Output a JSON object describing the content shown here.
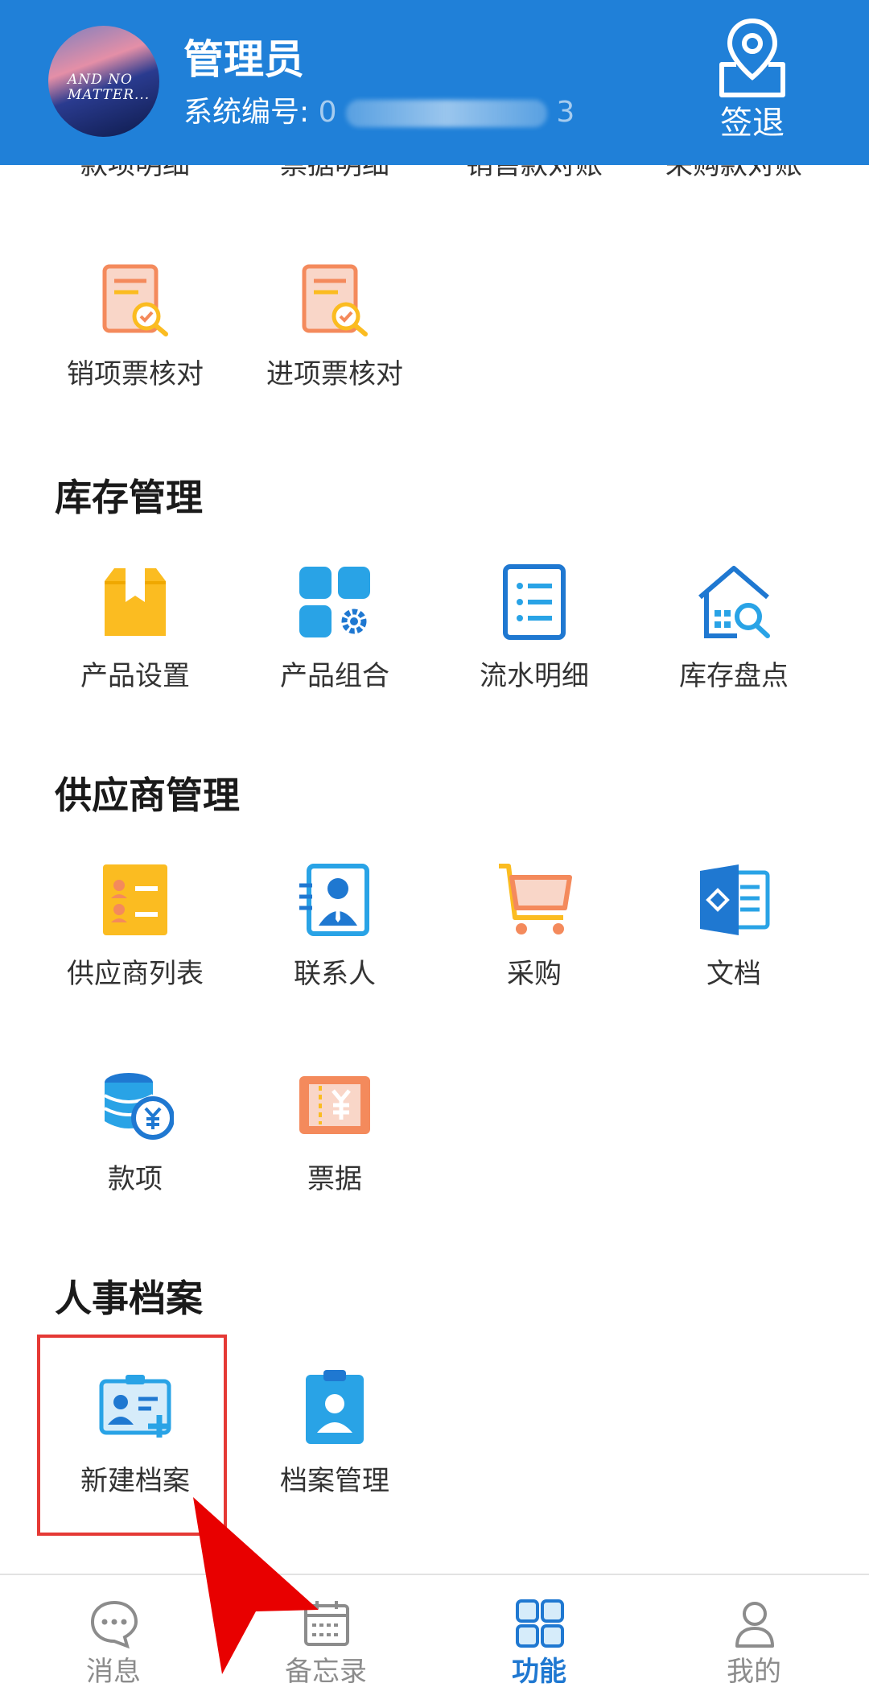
{
  "header": {
    "avatar_text": "AND NO MATTER...",
    "user_name": "管理员",
    "system_no_label": "系统编号:",
    "system_no_value_start": "0",
    "system_no_value_end": "3",
    "logout_label": "签退"
  },
  "top_cut_row": {
    "items": [
      "款项明细",
      "票据明细",
      "销售款对账",
      "采购款对账"
    ]
  },
  "finance_row2": {
    "items": [
      {
        "label": "销项票核对",
        "icon": "invoice-check-icon"
      },
      {
        "label": "进项票核对",
        "icon": "invoice-check-icon"
      }
    ]
  },
  "inventory": {
    "title": "库存管理",
    "items": [
      {
        "label": "产品设置",
        "icon": "product-box-icon"
      },
      {
        "label": "产品组合",
        "icon": "product-combo-icon"
      },
      {
        "label": "流水明细",
        "icon": "list-detail-icon"
      },
      {
        "label": "库存盘点",
        "icon": "warehouse-search-icon"
      }
    ]
  },
  "supplier": {
    "title": "供应商管理",
    "items": [
      {
        "label": "供应商列表",
        "icon": "supplier-list-icon"
      },
      {
        "label": "联系人",
        "icon": "contact-icon"
      },
      {
        "label": "采购",
        "icon": "cart-icon"
      },
      {
        "label": "文档",
        "icon": "document-icon"
      },
      {
        "label": "款项",
        "icon": "coins-icon"
      },
      {
        "label": "票据",
        "icon": "ticket-icon"
      }
    ]
  },
  "hr": {
    "title": "人事档案",
    "items": [
      {
        "label": "新建档案",
        "icon": "new-profile-icon"
      },
      {
        "label": "档案管理",
        "icon": "profile-manage-icon"
      }
    ]
  },
  "bottom_nav": {
    "items": [
      {
        "label": "消息",
        "icon": "message-icon",
        "active": false
      },
      {
        "label": "备忘录",
        "icon": "calendar-icon",
        "active": false
      },
      {
        "label": "功能",
        "icon": "grid-icon",
        "active": true
      },
      {
        "label": "我的",
        "icon": "user-icon",
        "active": false
      }
    ]
  },
  "colors": {
    "header_bg": "#2080d8",
    "accent_blue": "#1f78d1",
    "orange": "#f48a5c",
    "yellow": "#fbbc21",
    "highlight_red": "#e53935"
  }
}
